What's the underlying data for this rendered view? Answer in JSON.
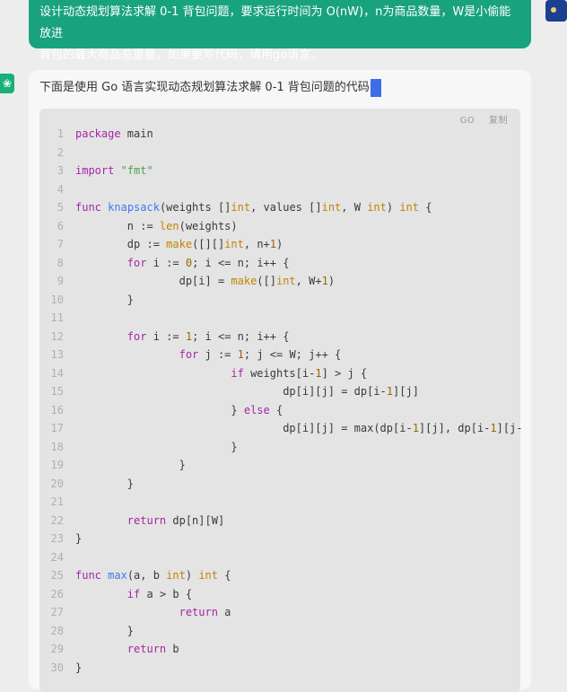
{
  "user_message": {
    "line1": "设计动态规划算法求解 0-1 背包问题，要求运行时间为 O(nW)，n为商品数量，W是小偷能放进",
    "line2": "背包的最大商品总重量。如果要写代码，请用go语言。"
  },
  "assistant": {
    "intro": "下面是使用 Go 语言实现动态规划算法求解 0-1 背包问题的代码"
  },
  "code_toolbar": {
    "language": "GO",
    "copy_label": "复制"
  },
  "code": {
    "line_numbers": [
      "1",
      "2",
      "3",
      "4",
      "5",
      "6",
      "7",
      "8",
      "9",
      "10",
      "11",
      "12",
      "13",
      "14",
      "15",
      "16",
      "17",
      "18",
      "19",
      "20",
      "21",
      "22",
      "23",
      "24",
      "25",
      "26",
      "27",
      "28",
      "29",
      "30"
    ]
  },
  "colors": {
    "user_bubble": "#19a27e",
    "code_bg": "#e4e4e4",
    "cursor": "#3d6ee8"
  }
}
